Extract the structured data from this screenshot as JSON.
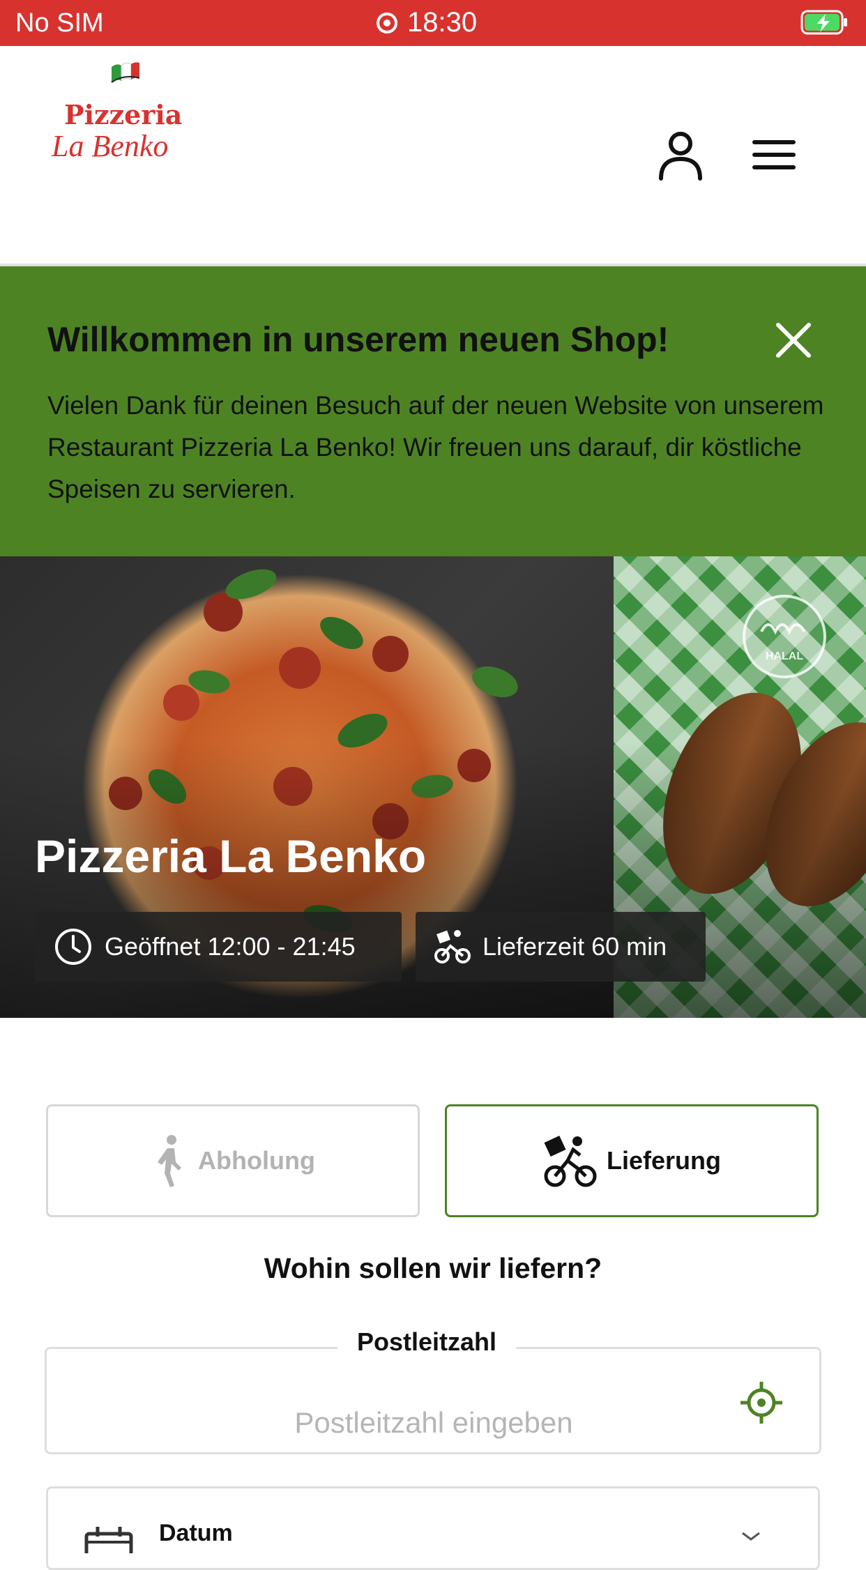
{
  "status_bar": {
    "carrier": "No SIM",
    "time": "18:30"
  },
  "header": {
    "logo_line1": "Pizzeria",
    "logo_line2": "La Benko",
    "user_icon": "user-icon",
    "menu_icon": "hamburger-menu-icon"
  },
  "banner": {
    "title": "Willkommen in unserem neuen Shop!",
    "text": "Vielen Dank für deinen Besuch auf der neuen Website von unserem Restaurant Pizzeria La Benko! Wir freuen uns darauf, dir köstliche Speisen zu servieren.",
    "background": "#4e8324"
  },
  "hero": {
    "title": "Pizzeria La Benko",
    "opening_hours": "Geöffnet 12:00 - 21:45",
    "delivery_time": "Lieferzeit 60 min",
    "halal_badge": "HALAL"
  },
  "order_mode": {
    "pickup_label": "Abholung",
    "delivery_label": "Lieferung",
    "selected": "delivery"
  },
  "delivery_form": {
    "question": "Wohin sollen wir liefern?",
    "postal_label": "Postleitzahl",
    "postal_placeholder": "Postleitzahl eingeben",
    "postal_value": "",
    "date_label": "Datum"
  },
  "colors": {
    "brand_red": "#d8322f",
    "accent_green": "#4e8324"
  }
}
